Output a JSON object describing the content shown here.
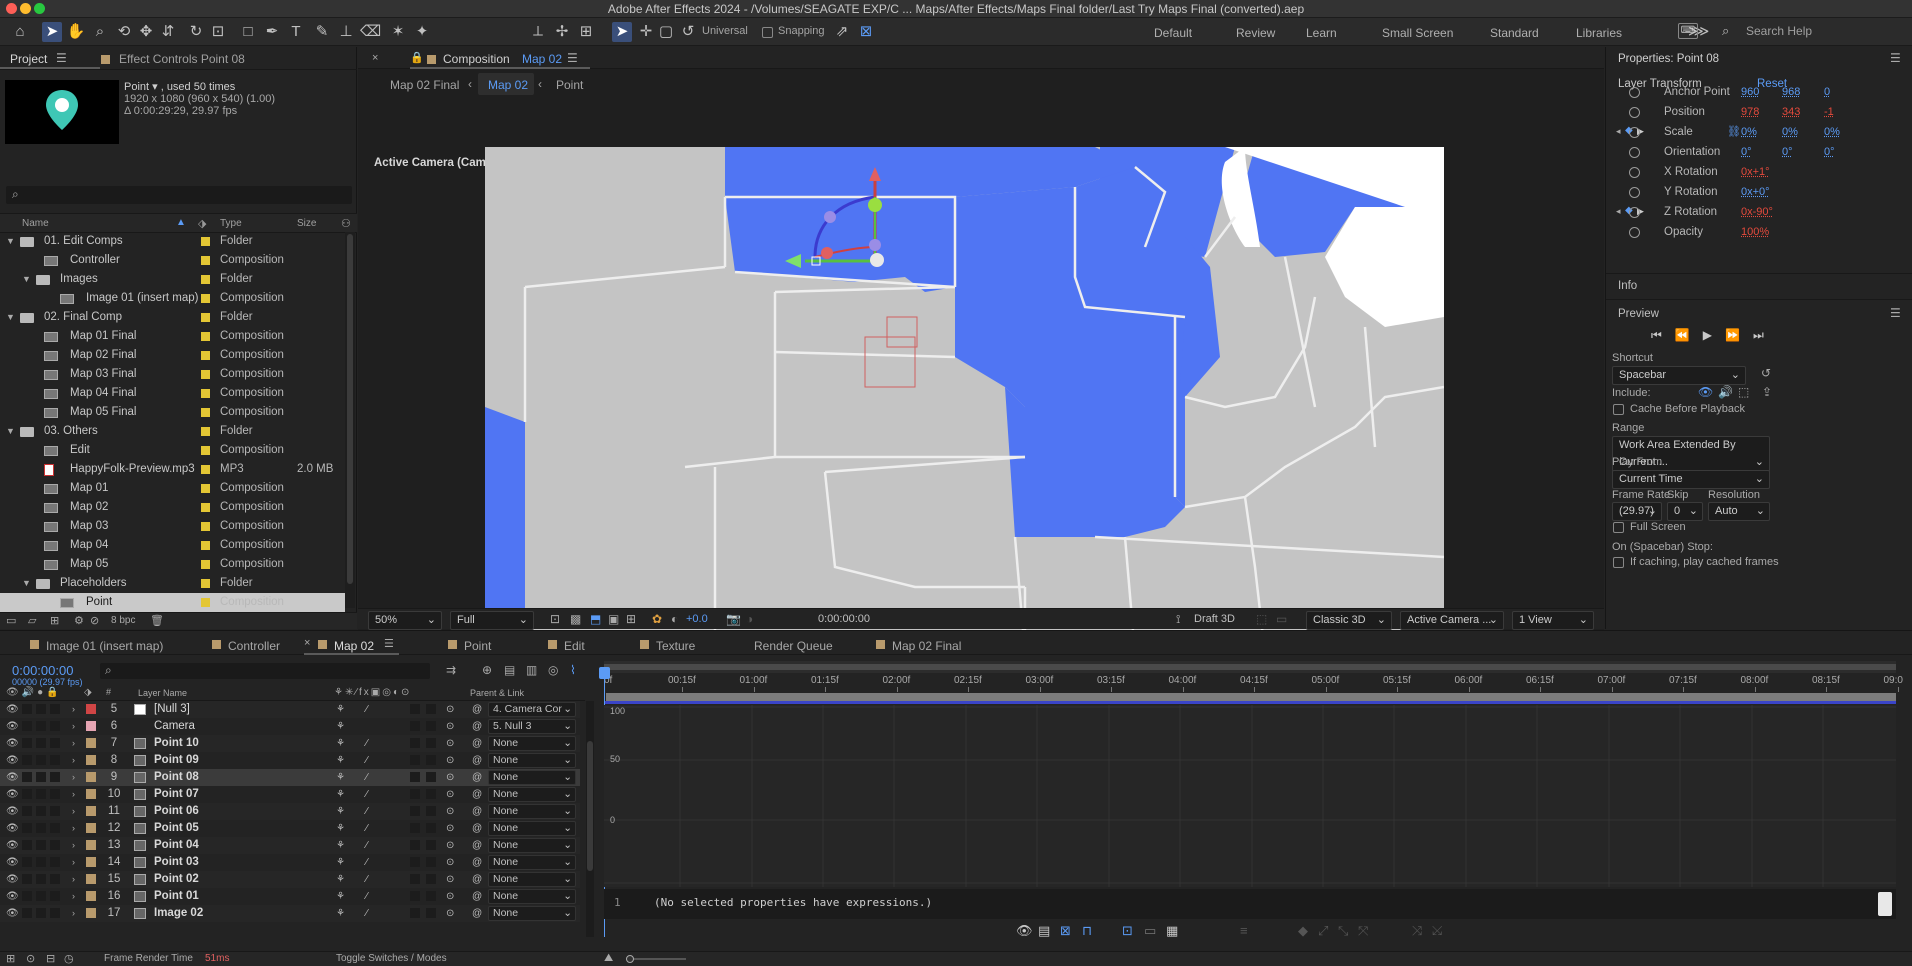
{
  "window": {
    "title": "Adobe After Effects 2024 - /Volumes/SEAGATE EXP/C ...  Maps/After Effects/Maps Final folder/Last Try Maps Final (converted).aep"
  },
  "toolbar": {
    "snap_mode": "Universal",
    "snapping_label": "Snapping",
    "search_placeholder": "Search Help",
    "workspaces": [
      "Default",
      "Review",
      "Learn",
      "Small Screen",
      "Standard",
      "Libraries"
    ]
  },
  "project": {
    "tab_project": "Project",
    "tab_effect_controls": "Effect Controls Point 08",
    "item_name": "Point ▾ , used 50 times",
    "item_dims": "1920 x 1080  (960 x 540) (1.00)",
    "item_dur": "Δ 0:00:29:29, 29.97 fps",
    "search_placeholder": "",
    "col_name": "Name",
    "col_type": "Type",
    "col_size": "Size",
    "bpc": "8 bpc",
    "items": [
      {
        "name": "01. Edit Comps",
        "type": "Folder",
        "size": "",
        "indent": 0,
        "kind": "folder",
        "open": true,
        "color": "#e3c634"
      },
      {
        "name": "Controller",
        "type": "Composition",
        "size": "",
        "indent": 1,
        "kind": "comp",
        "color": "#e3c634"
      },
      {
        "name": "Images",
        "type": "Folder",
        "size": "",
        "indent": 1,
        "kind": "folder",
        "open": true,
        "color": "#e3c634"
      },
      {
        "name": "Image 01 (insert map)",
        "type": "Composition",
        "size": "",
        "indent": 2,
        "kind": "comp",
        "color": "#e3c634"
      },
      {
        "name": "02. Final Comp",
        "type": "Folder",
        "size": "",
        "indent": 0,
        "kind": "folder",
        "open": true,
        "color": "#e3c634"
      },
      {
        "name": "Map 01 Final",
        "type": "Composition",
        "size": "",
        "indent": 1,
        "kind": "comp",
        "color": "#e3c634"
      },
      {
        "name": "Map 02 Final",
        "type": "Composition",
        "size": "",
        "indent": 1,
        "kind": "comp",
        "color": "#e3c634"
      },
      {
        "name": "Map 03 Final",
        "type": "Composition",
        "size": "",
        "indent": 1,
        "kind": "comp",
        "color": "#e3c634"
      },
      {
        "name": "Map 04 Final",
        "type": "Composition",
        "size": "",
        "indent": 1,
        "kind": "comp",
        "color": "#e3c634"
      },
      {
        "name": "Map 05 Final",
        "type": "Composition",
        "size": "",
        "indent": 1,
        "kind": "comp",
        "color": "#e3c634"
      },
      {
        "name": "03. Others",
        "type": "Folder",
        "size": "",
        "indent": 0,
        "kind": "folder",
        "open": true,
        "color": "#e3c634"
      },
      {
        "name": "Edit",
        "type": "Composition",
        "size": "",
        "indent": 1,
        "kind": "comp",
        "color": "#e3c634"
      },
      {
        "name": "HappyFolk-Preview.mp3",
        "type": "MP3",
        "size": "2.0 MB",
        "indent": 1,
        "kind": "audio",
        "color": "#e3c634"
      },
      {
        "name": "Map 01",
        "type": "Composition",
        "size": "",
        "indent": 1,
        "kind": "comp",
        "color": "#e3c634"
      },
      {
        "name": "Map 02",
        "type": "Composition",
        "size": "",
        "indent": 1,
        "kind": "comp",
        "color": "#e3c634"
      },
      {
        "name": "Map 03",
        "type": "Composition",
        "size": "",
        "indent": 1,
        "kind": "comp",
        "color": "#e3c634"
      },
      {
        "name": "Map 04",
        "type": "Composition",
        "size": "",
        "indent": 1,
        "kind": "comp",
        "color": "#e3c634"
      },
      {
        "name": "Map 05",
        "type": "Composition",
        "size": "",
        "indent": 1,
        "kind": "comp",
        "color": "#e3c634"
      },
      {
        "name": "Placeholders",
        "type": "Folder",
        "size": "",
        "indent": 1,
        "kind": "folder",
        "open": true,
        "color": "#e3c634"
      },
      {
        "name": "Point",
        "type": "Composition",
        "size": "",
        "indent": 2,
        "kind": "comp",
        "color": "#e3c634",
        "selected": true
      }
    ]
  },
  "viewer": {
    "tab": "Composition",
    "tab_comp": "Map 02",
    "crumbs": [
      "Map 02 Final",
      "Map 02",
      "Point"
    ],
    "camera_label": "Active Camera (Camera)",
    "zoom": "50%",
    "resolution": "Full",
    "exposure": "+0.0",
    "timecode": "0:00:00:00",
    "draft": "Draft 3D",
    "renderer": "Classic 3D",
    "camera": "Active Camera ...",
    "views": "1 View"
  },
  "props": {
    "title": "Properties: Point 08",
    "group": "Layer Transform",
    "reset": "Reset",
    "rows": [
      {
        "label": "Anchor Point",
        "v1": "960",
        "v2": "968",
        "v3": "0",
        "c": "blue"
      },
      {
        "label": "Position",
        "v1": "978",
        "v2": "343",
        "v3": "-1",
        "c": "red"
      },
      {
        "label": "Scale",
        "v1": "0%",
        "v2": "0%",
        "v3": "0%",
        "c": "blue"
      },
      {
        "label": "Orientation",
        "v1": "0°",
        "v2": "0°",
        "v3": "0°",
        "c": "blue"
      },
      {
        "label": "X Rotation",
        "v1": "0x+1°",
        "v2": "",
        "v3": "",
        "c": "red"
      },
      {
        "label": "Y Rotation",
        "v1": "0x+0°",
        "v2": "",
        "v3": "",
        "c": "blue"
      },
      {
        "label": "Z Rotation",
        "v1": "0x-90°",
        "v2": "",
        "v3": "",
        "c": "red"
      },
      {
        "label": "Opacity",
        "v1": "100%",
        "v2": "",
        "v3": "",
        "c": "red"
      }
    ],
    "info": "Info"
  },
  "preview": {
    "title": "Preview",
    "shortcut_label": "Shortcut",
    "shortcut": "Spacebar",
    "include": "Include:",
    "cache": "Cache Before Playback",
    "range_label": "Range",
    "range": "Work Area Extended By Current ...",
    "play_from_label": "Play From",
    "play_from": "Current Time",
    "fr_label": "Frame Rate",
    "skip_label": "Skip",
    "res_label": "Resolution",
    "fr": "(29.97)",
    "skip": "0",
    "res": "Auto",
    "full_screen": "Full Screen",
    "stop_label": "On (Spacebar) Stop:",
    "stop_opt": "If caching, play cached frames"
  },
  "timeline": {
    "tabs": [
      {
        "name": "Image 01 (insert map)",
        "active": false
      },
      {
        "name": "Controller",
        "active": false
      },
      {
        "name": "Map 02",
        "active": true
      },
      {
        "name": "Point",
        "active": false
      },
      {
        "name": "Edit",
        "active": false
      },
      {
        "name": "Texture",
        "active": false
      },
      {
        "name": "Render Queue",
        "active": false
      },
      {
        "name": "Map 02 Final",
        "active": false
      }
    ],
    "time": "0:00:00:00",
    "frames": "00000 (29.97 fps)",
    "col_layer": "Layer Name",
    "col_parent": "Parent & Link",
    "layers": [
      {
        "num": "5",
        "name": "[Null 3]",
        "color": "#d04545",
        "parent": "4. Camera Cor",
        "type": "null"
      },
      {
        "num": "6",
        "name": "Camera",
        "color": "#e6a5b3",
        "parent": "5. Null 3",
        "type": "camera"
      },
      {
        "num": "7",
        "name": "Point 10",
        "color": "#b89a6c",
        "parent": "None",
        "type": "comp"
      },
      {
        "num": "8",
        "name": "Point 09",
        "color": "#b89a6c",
        "parent": "None",
        "type": "comp"
      },
      {
        "num": "9",
        "name": "Point 08",
        "color": "#b89a6c",
        "parent": "None",
        "type": "comp",
        "selected": true
      },
      {
        "num": "10",
        "name": "Point 07",
        "color": "#b89a6c",
        "parent": "None",
        "type": "comp"
      },
      {
        "num": "11",
        "name": "Point 06",
        "color": "#b89a6c",
        "parent": "None",
        "type": "comp"
      },
      {
        "num": "12",
        "name": "Point 05",
        "color": "#b89a6c",
        "parent": "None",
        "type": "comp"
      },
      {
        "num": "13",
        "name": "Point 04",
        "color": "#b89a6c",
        "parent": "None",
        "type": "comp"
      },
      {
        "num": "14",
        "name": "Point 03",
        "color": "#b89a6c",
        "parent": "None",
        "type": "comp"
      },
      {
        "num": "15",
        "name": "Point 02",
        "color": "#b89a6c",
        "parent": "None",
        "type": "comp"
      },
      {
        "num": "16",
        "name": "Point 01",
        "color": "#b89a6c",
        "parent": "None",
        "type": "comp"
      },
      {
        "num": "17",
        "name": "Image 02",
        "color": "#b89a6c",
        "parent": "None",
        "type": "comp"
      }
    ],
    "ruler": [
      "00:15f",
      "01:00f",
      "01:15f",
      "02:00f",
      "02:15f",
      "03:00f",
      "03:15f",
      "04:00f",
      "04:15f",
      "05:00f",
      "05:15f",
      "06:00f",
      "06:15f",
      "07:00f",
      "07:15f",
      "08:00f",
      "08:15f",
      "09:0"
    ],
    "graph_labels": [
      "100",
      "50",
      "0"
    ],
    "expr_line": "1",
    "expr_text": "(No selected properties have expressions.)",
    "footer_render": "Frame Render Time",
    "footer_ms": "51ms",
    "footer_toggle": "Toggle Switches / Modes"
  }
}
